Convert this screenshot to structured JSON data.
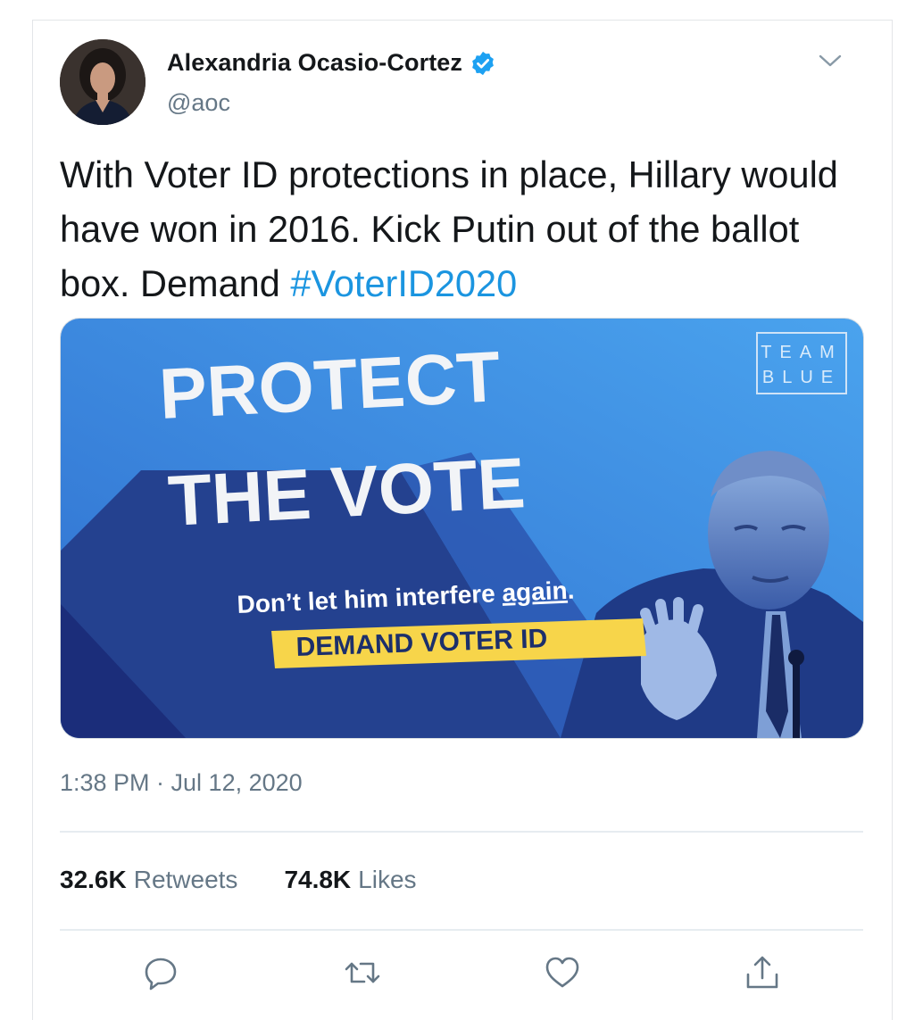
{
  "tweet": {
    "author_name": "Alexandria Ocasio-Cortez",
    "handle": "@aoc",
    "text_main": "With Voter ID protections in place, Hillary would have won in 2016. Kick Putin out of the ballot box. Demand ",
    "hashtag": "#VoterID2020",
    "timestamp": "1:38 PM · Jul 12, 2020"
  },
  "media": {
    "brand_line1": "TEAM",
    "brand_line2": "BLUE",
    "headline_line1": "PROTECT",
    "headline_line2": "THE VOTE",
    "subline_prefix": "Don’t let him interfere ",
    "subline_underlined": "again",
    "subline_suffix": ".",
    "cta": "DEMAND VOTER ID"
  },
  "stats": {
    "retweets_count": "32.6K",
    "retweets_label": "Retweets",
    "likes_count": "74.8K",
    "likes_label": "Likes"
  },
  "icons": {
    "verified": "verified-badge-icon",
    "menu": "chevron-down-icon",
    "reply": "reply-icon",
    "retweet": "retweet-icon",
    "like": "heart-icon",
    "share": "share-icon"
  },
  "colors": {
    "hashtag": "#1b95e0",
    "verified": "#1da1f2",
    "media_blue_light": "#3a93e4",
    "media_blue_dark": "#1c2f82",
    "cta_yellow": "#f7d54a"
  }
}
